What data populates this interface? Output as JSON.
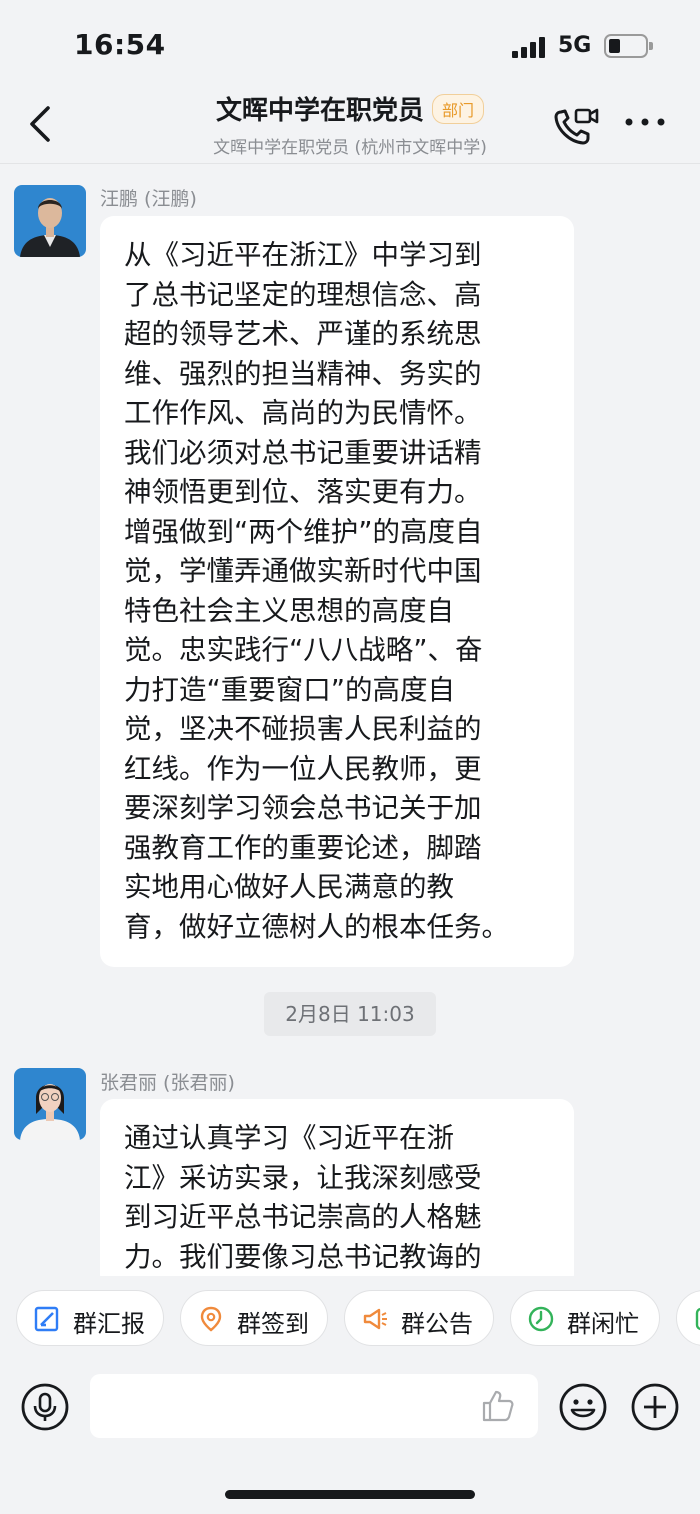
{
  "status_bar": {
    "time": "16:54",
    "network": "5G"
  },
  "header": {
    "title": "文晖中学在职党员",
    "tag": "部门",
    "subtitle": "文晖中学在职党员 (杭州市文晖中学)"
  },
  "messages": [
    {
      "sender": "汪鹏 (汪鹏)",
      "lines": [
        "从《习近平在浙江》中学习到",
        "了总书记坚定的理想信念、高",
        "超的领导艺术、严谨的系统思",
        "维、强烈的担当精神、务实的",
        "工作作风、高尚的为民情怀。",
        "我们必须对总书记重要讲话精",
        "神领悟更到位、落实更有力。",
        "增强做到“两个维护”的高度自",
        "觉，学懂弄通做实新时代中国",
        "特色社会主义思想的高度自",
        "觉。忠实践行“八八战略”、奋",
        "力打造“重要窗口”的高度自",
        "觉，坚决不碰损害人民利益的",
        "红线。作为一位人民教师，更",
        "要深刻学习领会总书记关于加",
        "强教育工作的重要论述，脚踏",
        "实地用心做好人民满意的教",
        "育，做好立德树人的根本任务。"
      ]
    },
    {
      "sender": "张君丽 (张君丽)",
      "lines": [
        "通过认真学习《习近平在浙",
        "江》采访实录，让我深刻感受",
        "到习近平总书记崇高的人格魅",
        "力。我们要像习总书记教诲的"
      ]
    }
  ],
  "timestamp": "2月8日 11:03",
  "quick_actions": [
    {
      "label": "群汇报",
      "icon": "report-icon",
      "color": "#2f7df6"
    },
    {
      "label": "群签到",
      "icon": "location-pin-icon",
      "color": "#f08a3c"
    },
    {
      "label": "群公告",
      "icon": "megaphone-icon",
      "color": "#f08a3c"
    },
    {
      "label": "群闲忙",
      "icon": "clock-icon",
      "color": "#33b35a"
    }
  ],
  "colors": {
    "background": "#f2f3f5",
    "bubble": "#ffffff",
    "tag": "#e89a2a"
  }
}
